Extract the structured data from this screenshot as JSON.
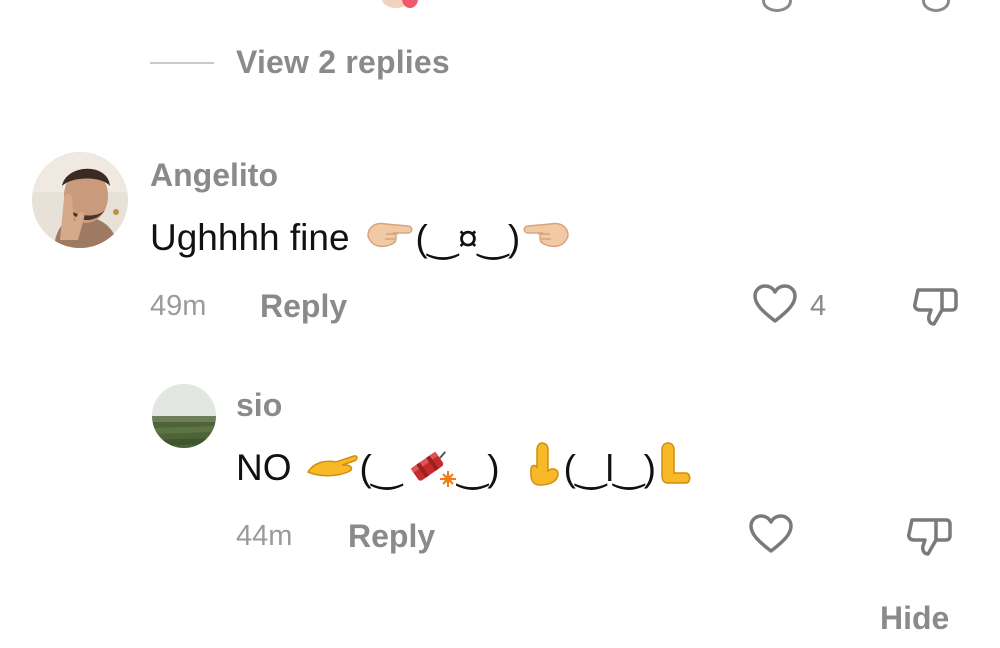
{
  "thread": {
    "view_replies_label": "View 2 replies",
    "hide_label": "Hide"
  },
  "comments": [
    {
      "username": "Angelito",
      "text_prefix": "Ughhhh fine",
      "kaomoji": "(‿¤‿)",
      "time": "49m",
      "reply_label": "Reply",
      "like_count": "4",
      "emojis": [
        "hand-pointing-right-emoji",
        "hand-pointing-left-emoji"
      ]
    },
    {
      "username": "sio",
      "text_prefix": "NO",
      "kaomoji_1": "(‿",
      "kaomoji_2": "‿)",
      "kaomoji_3": "(‿l‿)",
      "time": "44m",
      "reply_label": "Reply",
      "emojis": [
        "hand-offering-emoji",
        "firecracker-emoji",
        "palm-up-hand-emoji",
        "palm-down-hand-emoji"
      ]
    }
  ],
  "colors": {
    "muted_text": "#8a8a8a",
    "primary_text": "#111111",
    "icon_stroke": "#7a7a7a",
    "skin_light": "#f1c9a5",
    "emoji_yellow": "#f7b928",
    "firecracker_red": "#c62b2b"
  }
}
